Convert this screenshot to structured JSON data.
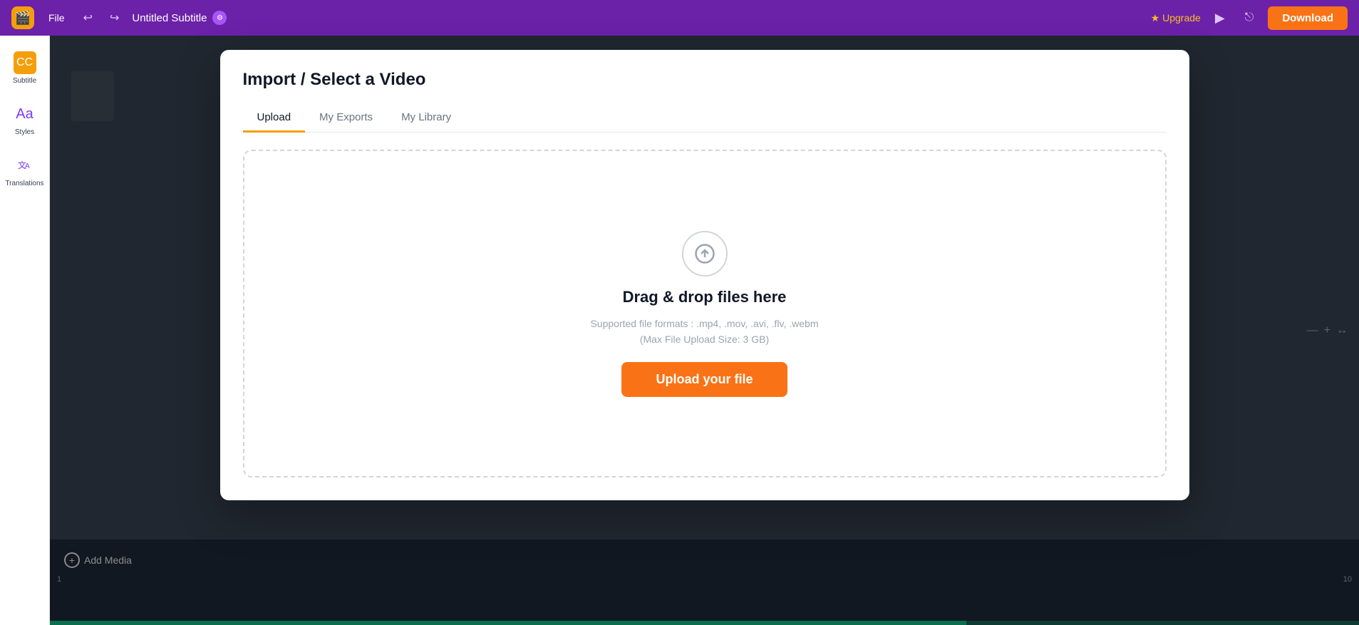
{
  "topbar": {
    "logo_text": "★",
    "file_label": "File",
    "title": "Untitled Subtitle",
    "upgrade_label": "Upgrade",
    "download_label": "Download"
  },
  "sidebar": {
    "items": [
      {
        "id": "subtitle",
        "label": "Subtitle",
        "icon": "CC"
      },
      {
        "id": "styles",
        "label": "Styles",
        "icon": "Aa"
      },
      {
        "id": "translations",
        "label": "Translations",
        "icon": "文A"
      }
    ]
  },
  "modal": {
    "title": "Import / Select a Video",
    "tabs": [
      {
        "id": "upload",
        "label": "Upload",
        "active": true
      },
      {
        "id": "my-exports",
        "label": "My Exports",
        "active": false
      },
      {
        "id": "my-library",
        "label": "My Library",
        "active": false
      }
    ],
    "upload": {
      "drag_text": "Drag & drop files here",
      "formats_text": "Supported file formats : .mp4, .mov, .avi, .flv, .webm",
      "size_text": "(Max File Upload Size: 3 GB)",
      "button_label": "Upload your file"
    }
  },
  "timeline": {
    "start_number": "1",
    "end_number": "10",
    "add_media_label": "Add Media"
  }
}
